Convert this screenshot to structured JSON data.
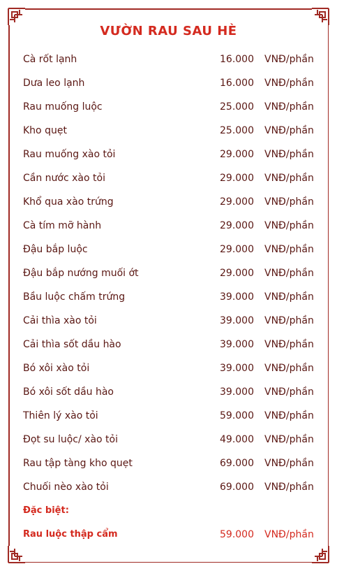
{
  "title": "VƯỜN RAU SAU HÈ",
  "items": [
    {
      "name": "Cà rốt lạnh",
      "price": "16.000",
      "unit": "VNĐ/phần"
    },
    {
      "name": "Dưa leo lạnh",
      "price": "16.000",
      "unit": "VNĐ/phần"
    },
    {
      "name": "Rau muống luộc",
      "price": "25.000",
      "unit": "VNĐ/phần"
    },
    {
      "name": "Kho quẹt",
      "price": "25.000",
      "unit": "VNĐ/phần"
    },
    {
      "name": "Rau muống xào tỏi",
      "price": "29.000",
      "unit": "VNĐ/phần"
    },
    {
      "name": "Cần nước xào tỏi",
      "price": "29.000",
      "unit": "VNĐ/phần"
    },
    {
      "name": "Khổ qua xào trứng",
      "price": "29.000",
      "unit": "VNĐ/phần"
    },
    {
      "name": "Cà tím mỡ hành",
      "price": "29.000",
      "unit": "VNĐ/phần"
    },
    {
      "name": "Đậu bắp luộc",
      "price": "29.000",
      "unit": "VNĐ/phần"
    },
    {
      "name": "Đậu bắp nướng muối ớt",
      "price": "29.000",
      "unit": "VNĐ/phần"
    },
    {
      "name": "Bầu luộc chấm trứng",
      "price": "39.000",
      "unit": "VNĐ/phần"
    },
    {
      "name": "Cải thìa xào tỏi",
      "price": "39.000",
      "unit": "VNĐ/phần"
    },
    {
      "name": "Cải thìa sốt dầu hào",
      "price": "39.000",
      "unit": "VNĐ/phần"
    },
    {
      "name": "Bó xôi xào tỏi",
      "price": "39.000",
      "unit": "VNĐ/phần"
    },
    {
      "name": "Bó xôi sốt dầu hào",
      "price": "39.000",
      "unit": "VNĐ/phần"
    },
    {
      "name": "Thiên lý xào tỏi",
      "price": "59.000",
      "unit": "VNĐ/phần"
    },
    {
      "name": "Đọt su luộc/ xào tỏi",
      "price": "49.000",
      "unit": "VNĐ/phần"
    },
    {
      "name": "Rau tập tàng kho quẹt",
      "price": "69.000",
      "unit": "VNĐ/phần"
    },
    {
      "name": "Chuối nèo xào tỏi",
      "price": "69.000",
      "unit": "VNĐ/phần"
    }
  ],
  "special_label": "Đặc biệt:",
  "special": {
    "name": "Rau luộc thập cẩm",
    "price": "59.000",
    "unit": "VNĐ/phần"
  },
  "colors": {
    "accent": "#d42a1f",
    "text": "#5a1713",
    "frame": "#a02a24"
  }
}
